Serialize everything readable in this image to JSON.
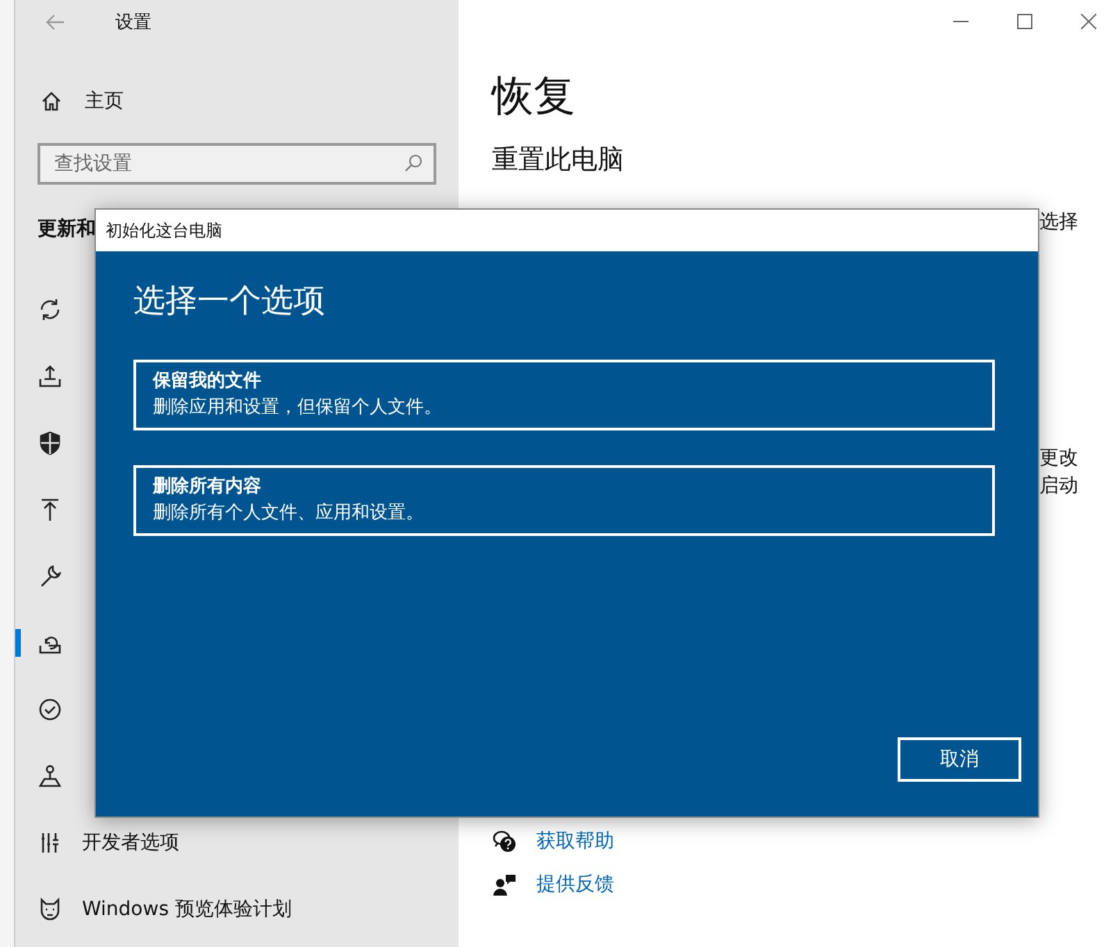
{
  "window": {
    "title": "设置"
  },
  "sidebar": {
    "home": "主页",
    "search": {
      "placeholder": "查找设置"
    },
    "section": "更新和",
    "items": [
      {
        "selected": false
      },
      {
        "selected": false
      },
      {
        "selected": false
      },
      {
        "selected": false
      },
      {
        "selected": false
      },
      {
        "selected": true
      },
      {
        "selected": false
      },
      {
        "selected": false
      },
      {
        "label": "开发者选项",
        "selected": false
      },
      {
        "label": "Windows 预览体验计划",
        "selected": false
      }
    ]
  },
  "main": {
    "title": "恢复",
    "subtitle": "重置此电脑",
    "peek_texts": [
      "选择",
      "更改",
      "启动"
    ],
    "links": [
      {
        "label": "获取帮助"
      },
      {
        "label": "提供反馈"
      }
    ]
  },
  "dialog": {
    "title": "初始化这台电脑",
    "heading": "选择一个选项",
    "options": [
      {
        "title": "保留我的文件",
        "description": "删除应用和设置，但保留个人文件。"
      },
      {
        "title": "删除所有内容",
        "description": "删除所有个人文件、应用和设置。"
      }
    ],
    "cancel": "取消"
  }
}
